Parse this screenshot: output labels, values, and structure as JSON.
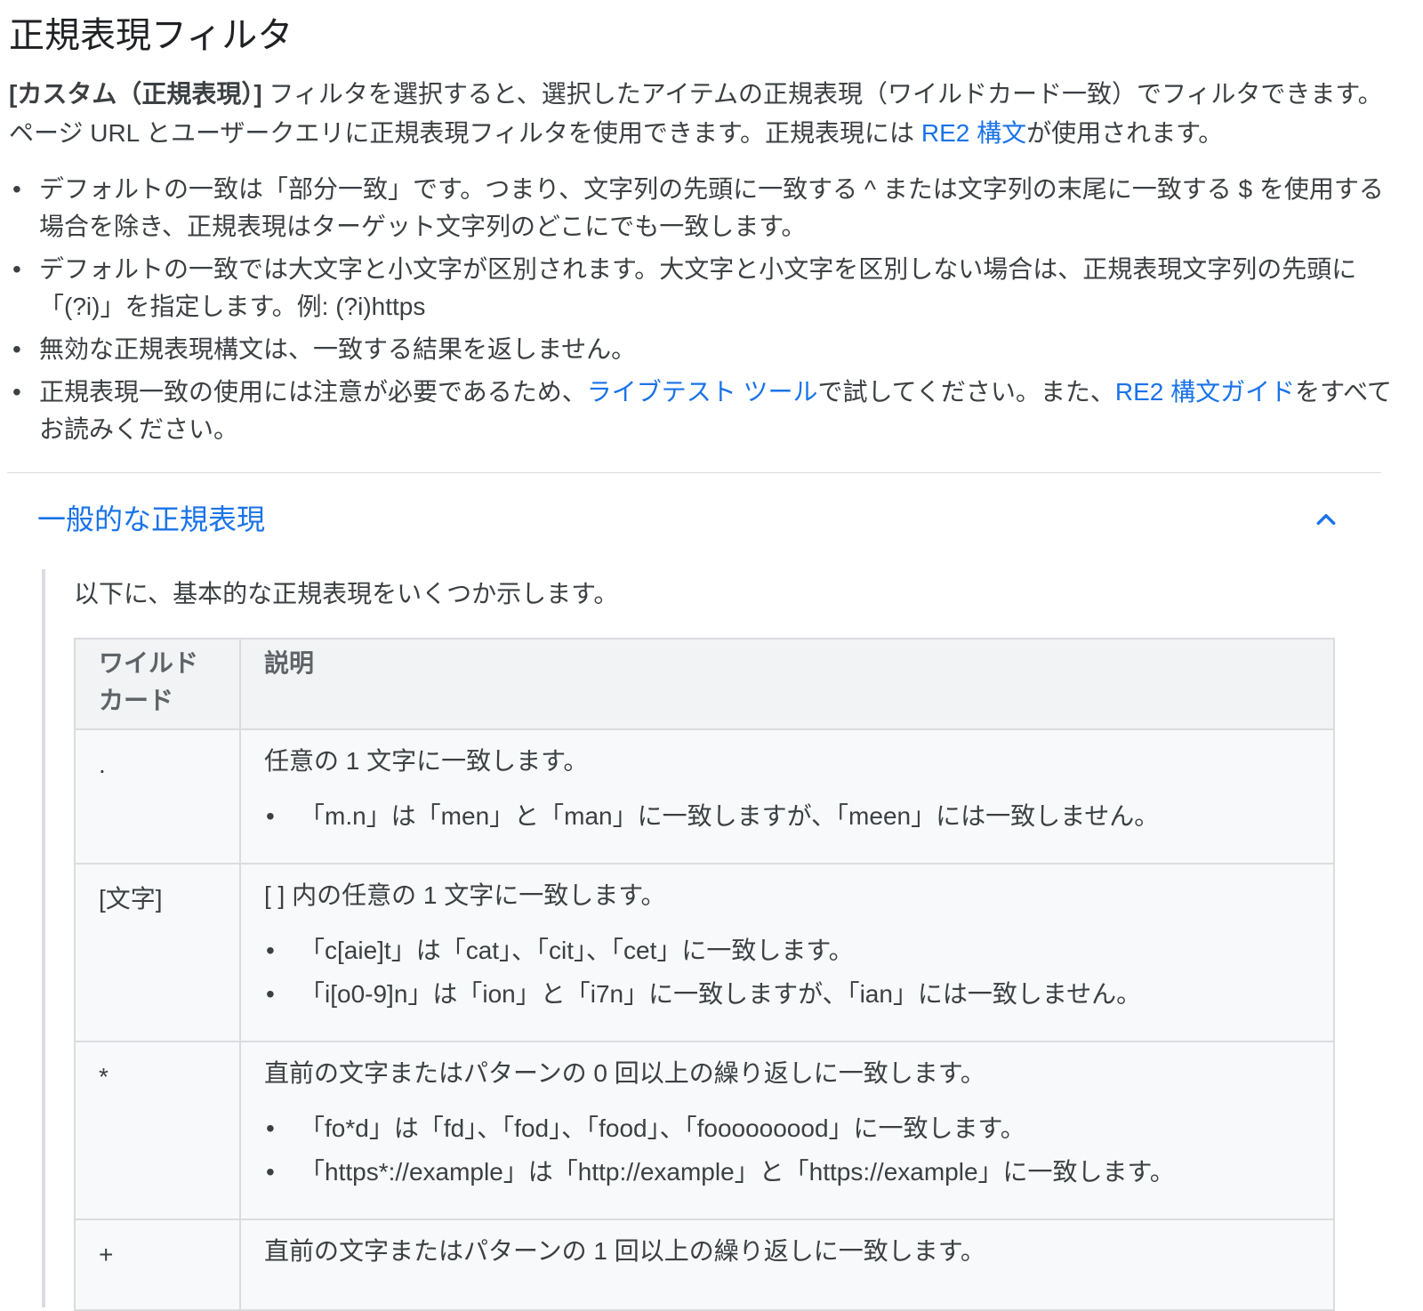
{
  "title": "正規表現フィルタ",
  "intro": {
    "bold": "[カスタム（正規表現）]",
    "text1": " フィルタを選択すると、選択したアイテムの正規表現（ワイルドカード一致）でフィルタできます。ページ URL とユーザークエリに正規表現フィルタを使用できます。正規表現には ",
    "link": "RE2 構文",
    "text2": "が使用されます。"
  },
  "bullets": {
    "b1": "デフォルトの一致は「部分一致」です。つまり、文字列の先頭に一致する ^ または文字列の末尾に一致する $ を使用する場合を除き、正規表現はターゲット文字列のどこにでも一致します。",
    "b2": "デフォルトの一致では大文字と小文字が区別されます。大文字と小文字を区別しない場合は、正規表現文字列の先頭に「(?i)」を指定します。例: (?i)https",
    "b3": "無効な正規表現構文は、一致する結果を返しません。",
    "b4_text1": "正規表現一致の使用には注意が必要であるため、",
    "b4_link1": "ライブテスト ツール",
    "b4_text2": "で試してください。また、",
    "b4_link2": "RE2 構文ガイド",
    "b4_text3": "をすべてお読みください。",
    "bullet_char": "•"
  },
  "section": {
    "title": "一般的な正規表現",
    "chevron_icon": "chevron-up-icon",
    "intro": "以下に、基本的な正規表現をいくつか示します。"
  },
  "table": {
    "headers": [
      "ワイルドカード",
      "説明"
    ],
    "rows": [
      {
        "wildcard": ".",
        "description": "任意の 1 文字に一致します。",
        "examples": [
          "「m.n」は「men」と「man」に一致しますが、「meen」には一致しません。"
        ]
      },
      {
        "wildcard": "[文字]",
        "description": "[ ] 内の任意の 1 文字に一致します。",
        "examples": [
          "「c[aie]t」は「cat」、「cit」、「cet」に一致します。",
          "「i[o0-9]n」は「ion」と「i7n」に一致しますが、「ian」には一致しません。"
        ]
      },
      {
        "wildcard": "*",
        "description": "直前の文字またはパターンの 0 回以上の繰り返しに一致します。",
        "examples": [
          "「fo*d」は「fd」、「fod」、「food」、「fooooooood」に一致します。",
          "「https*://example」は「http://example」と「https://example」に一致します。"
        ]
      },
      {
        "wildcard": "+",
        "description": "直前の文字またはパターンの 1 回以上の繰り返しに一致します。",
        "examples": []
      }
    ]
  },
  "colors": {
    "link": "#1a73e8",
    "text": "#3c4043",
    "header_bg": "#f1f3f4",
    "row_bg": "#f8f9fa",
    "border": "#dadce0"
  }
}
